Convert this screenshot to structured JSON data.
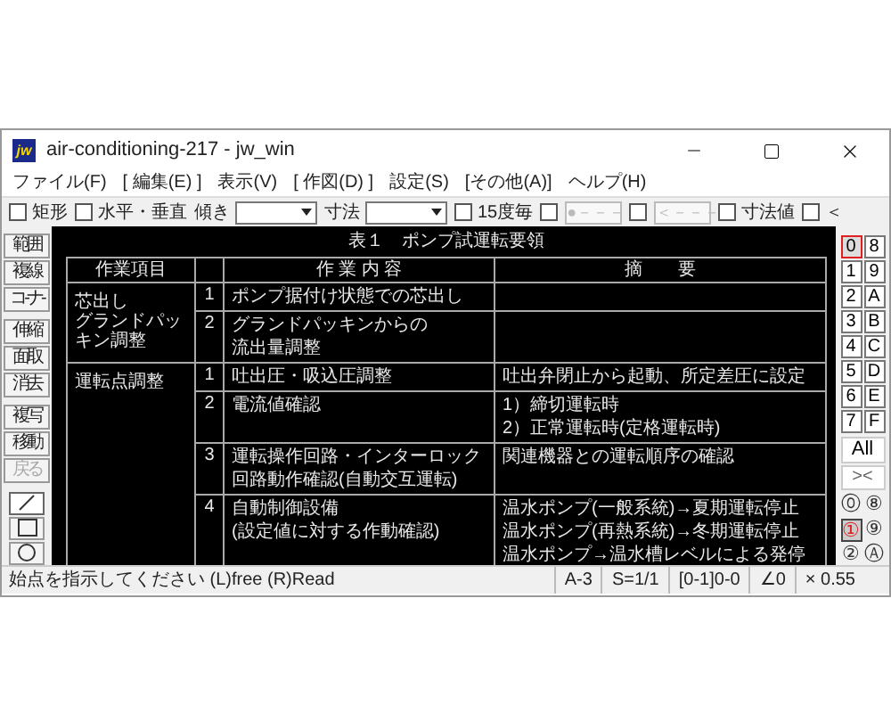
{
  "window": {
    "title": "air-conditioning-217 - jw_win",
    "app_icon": "jw"
  },
  "menu": [
    "ファイル(F)",
    "[ 編集(E) ]",
    "表示(V)",
    "[ 作図(D) ]",
    "設定(S)",
    "[その他(A)]",
    "ヘルプ(H)"
  ],
  "toolbar": [
    {
      "kind": "check",
      "label": "矩形",
      "checked": false
    },
    {
      "kind": "check",
      "label": "水平・垂直",
      "checked": false
    },
    {
      "kind": "combo",
      "label": "傾き"
    },
    {
      "kind": "combo",
      "label": "寸法"
    },
    {
      "kind": "check",
      "label": "15度毎",
      "checked": false
    },
    {
      "kind": "checkbox",
      "checked": false
    },
    {
      "kind": "greybox",
      "label": "●－－－"
    },
    {
      "kind": "checkbox",
      "checked": false
    },
    {
      "kind": "greybox",
      "label": "＜－－－"
    },
    {
      "kind": "check",
      "label": "寸法値",
      "checked": false
    },
    {
      "kind": "check",
      "label": "＜",
      "checked": false
    }
  ],
  "tools": [
    {
      "label": "範囲",
      "disabled": false
    },
    {
      "label": "複線",
      "disabled": false
    },
    {
      "label": "コ-ナ-",
      "disabled": false
    },
    {
      "label": "伸縮",
      "disabled": false
    },
    {
      "label": "面取",
      "disabled": false
    },
    {
      "label": "消去",
      "disabled": false
    },
    {
      "label": "複写",
      "disabled": false
    },
    {
      "label": "移動",
      "disabled": false
    },
    {
      "label": "戻る",
      "disabled": true
    }
  ],
  "draw_tools": [
    {
      "kind": "line",
      "selected": true
    },
    {
      "kind": "rect",
      "selected": false
    },
    {
      "kind": "circle",
      "selected": false
    }
  ],
  "table": {
    "title": "表１　ポンプ試運転要領",
    "columns": [
      "作業項目",
      "作 業 内 容",
      "摘　　要"
    ],
    "groups": [
      {
        "label": [
          "芯出し",
          "グランドパッ",
          "キン調整"
        ],
        "items": [
          {
            "no": "1",
            "content": [
              "ポンプ据付け状態での芯出し"
            ]
          },
          {
            "no": "2",
            "content": [
              "グランドパッキンからの",
              "流出量調整"
            ]
          }
        ]
      },
      {
        "label": [
          "運転点調整"
        ],
        "items": [
          {
            "no": "1",
            "content": [
              "吐出圧・吸込圧調整"
            ],
            "remarks": [
              "吐出弁閉止から起動、所定差圧に設定"
            ]
          },
          {
            "no": "2",
            "content": [
              "電流値確認"
            ],
            "remarks": [
              "1）締切運転時",
              "2）正常運転時(定格運転時)"
            ]
          },
          {
            "no": "3",
            "content": [
              "運転操作回路・インターロック",
              "回路動作確認(自動交互運転)"
            ],
            "remarks": [
              "関連機器との運転順序の確認"
            ]
          },
          {
            "no": "4",
            "content": [
              "自動制御設備",
              "(設定値に対する作動確認)"
            ],
            "remarks": [
              "温水ポンプ(一般系統)→夏期運転停止",
              "温水ポンプ(再熱系統)→冬期運転停止",
              "温水ポンプ→温水槽レベルによる発停"
            ]
          }
        ]
      }
    ]
  },
  "layers": [
    {
      "labels": [
        "0",
        "8"
      ],
      "selected": true
    },
    {
      "labels": [
        "1",
        "9"
      ],
      "selected": false
    },
    {
      "labels": [
        "2",
        "A"
      ],
      "selected": false
    },
    {
      "labels": [
        "3",
        "B"
      ],
      "selected": false
    },
    {
      "labels": [
        "4",
        "C"
      ],
      "selected": false
    },
    {
      "labels": [
        "5",
        "D"
      ],
      "selected": false
    },
    {
      "labels": [
        "6",
        "E"
      ],
      "selected": false
    },
    {
      "labels": [
        "7",
        "F"
      ],
      "selected": false
    }
  ],
  "all_button": "All",
  "cross_button": "><",
  "groups": [
    {
      "labels": [
        "⓪",
        "⑧"
      ],
      "selected": false
    },
    {
      "labels": [
        "①",
        "⑨"
      ],
      "selected": true
    },
    {
      "labels": [
        "②",
        "Ⓐ"
      ],
      "selected": false
    }
  ],
  "status": {
    "message": "始点を指示してください (L)free (R)Read",
    "fields": [
      "A-3",
      "S=1/1",
      "[0-1]0-0",
      "∠0",
      "× 0.55"
    ]
  }
}
